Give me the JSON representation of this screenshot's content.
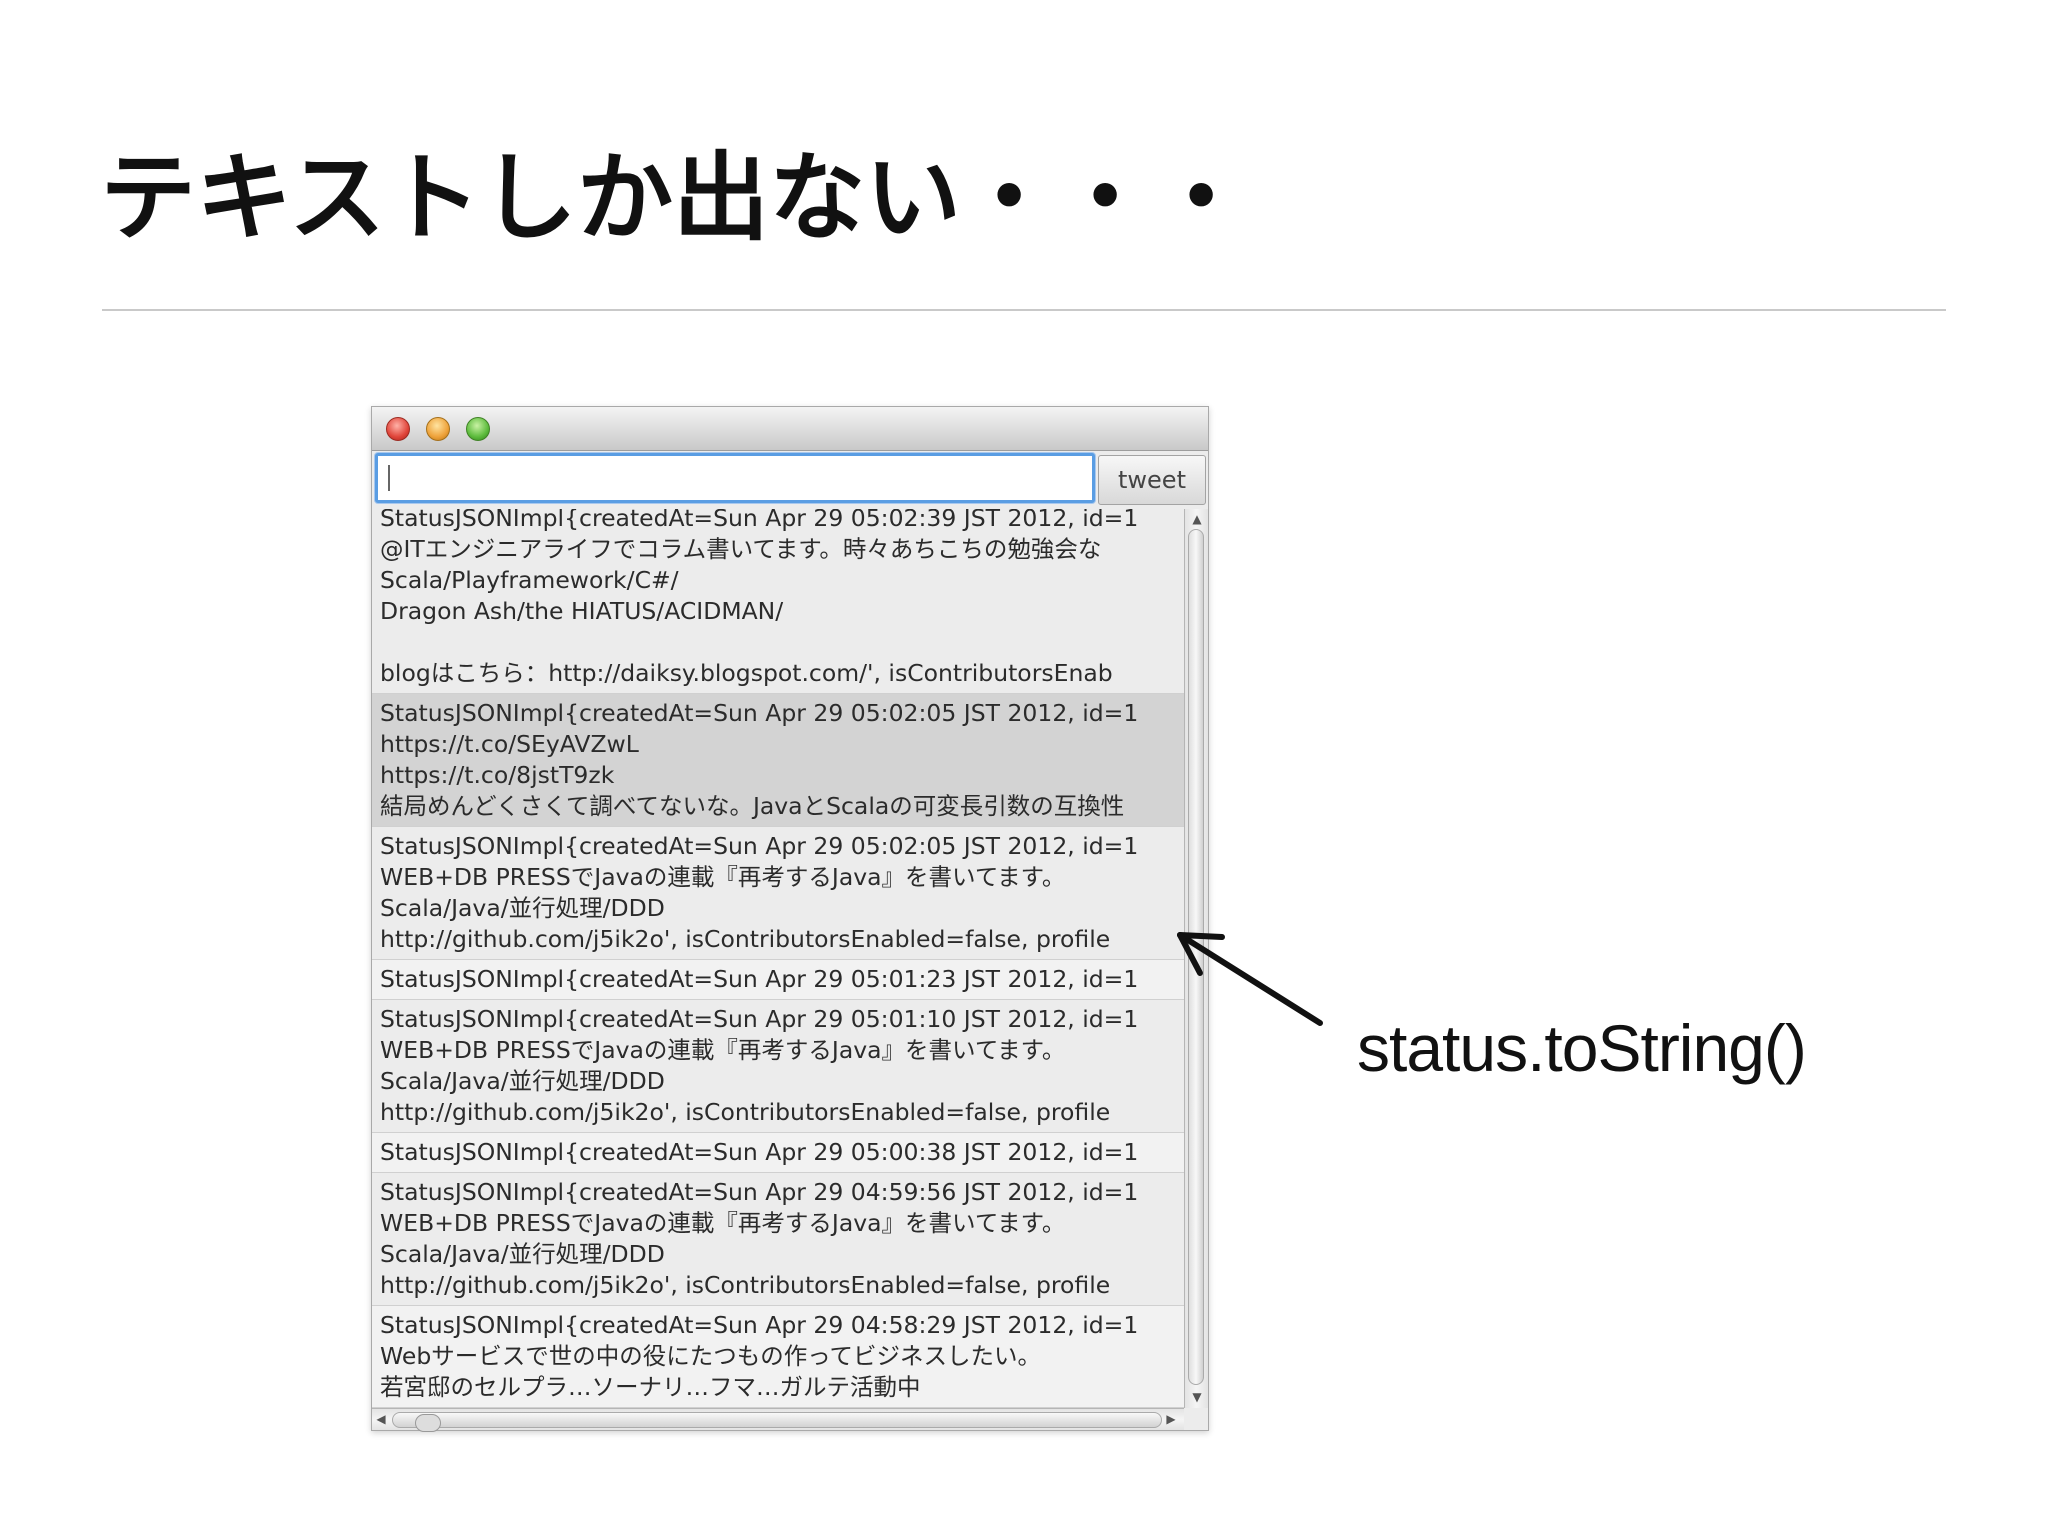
{
  "slide": {
    "title": "テキストしか出ない・・・",
    "annotation": "status.toString()"
  },
  "window": {
    "input": {
      "value": ""
    },
    "tweet_button_label": "tweet",
    "items": [
      {
        "lines": [
          "StatusJSONImpl{createdAt=Sun Apr 29 05:02:39 JST 2012, id=1",
          "@ITエンジニアライフでコラム書いてます。時々あちこちの勉強会な",
          "Scala/Playframework/C#/",
          "Dragon Ash/the HIATUS/ACIDMAN/",
          "",
          "blogはこちら：http://daiksy.blogspot.com/', isContributorsEnab"
        ]
      },
      {
        "lines": [
          "StatusJSONImpl{createdAt=Sun Apr 29 05:02:05 JST 2012, id=1",
          "https://t.co/SEyAVZwL",
          "https://t.co/8jstT9zk",
          "結局めんどくさくて調べてないな。JavaとScalaの可変長引数の互換性"
        ]
      },
      {
        "lines": [
          "StatusJSONImpl{createdAt=Sun Apr 29 05:02:05 JST 2012, id=1",
          "WEB+DB PRESSでJavaの連載『再考するJava』を書いてます。",
          "Scala/Java/並行処理/DDD",
          "http://github.com/j5ik2o', isContributorsEnabled=false, profile"
        ]
      },
      {
        "lines": [
          "StatusJSONImpl{createdAt=Sun Apr 29 05:01:23 JST 2012, id=1"
        ]
      },
      {
        "lines": [
          "StatusJSONImpl{createdAt=Sun Apr 29 05:01:10 JST 2012, id=1",
          "WEB+DB PRESSでJavaの連載『再考するJava』を書いてます。",
          "Scala/Java/並行処理/DDD",
          "http://github.com/j5ik2o', isContributorsEnabled=false, profile"
        ]
      },
      {
        "lines": [
          "StatusJSONImpl{createdAt=Sun Apr 29 05:00:38 JST 2012, id=1"
        ]
      },
      {
        "lines": [
          "StatusJSONImpl{createdAt=Sun Apr 29 04:59:56 JST 2012, id=1",
          "WEB+DB PRESSでJavaの連載『再考するJava』を書いてます。",
          "Scala/Java/並行処理/DDD",
          "http://github.com/j5ik2o', isContributorsEnabled=false, profile"
        ]
      },
      {
        "lines": [
          "StatusJSONImpl{createdAt=Sun Apr 29 04:58:29 JST 2012, id=1",
          "Webサービスで世の中の役にたつもの作ってビジネスしたい。",
          "若宮邸のセルプラ…ソーナリ…フマ…ガルテ活動中"
        ]
      }
    ]
  },
  "colors": {
    "input_focus": "#5a9de3",
    "selected_row": "#d3d3d3",
    "list_background": "#ececec"
  },
  "icons": {
    "close": "close-light-icon",
    "minimize": "minimize-light-icon",
    "maximize": "zoom-light-icon",
    "scroll_up": "triangle-up-icon",
    "scroll_down": "triangle-down-icon",
    "scroll_left": "triangle-left-icon",
    "scroll_right": "triangle-right-icon",
    "annotation_arrow": "hand-drawn-arrow-icon"
  }
}
